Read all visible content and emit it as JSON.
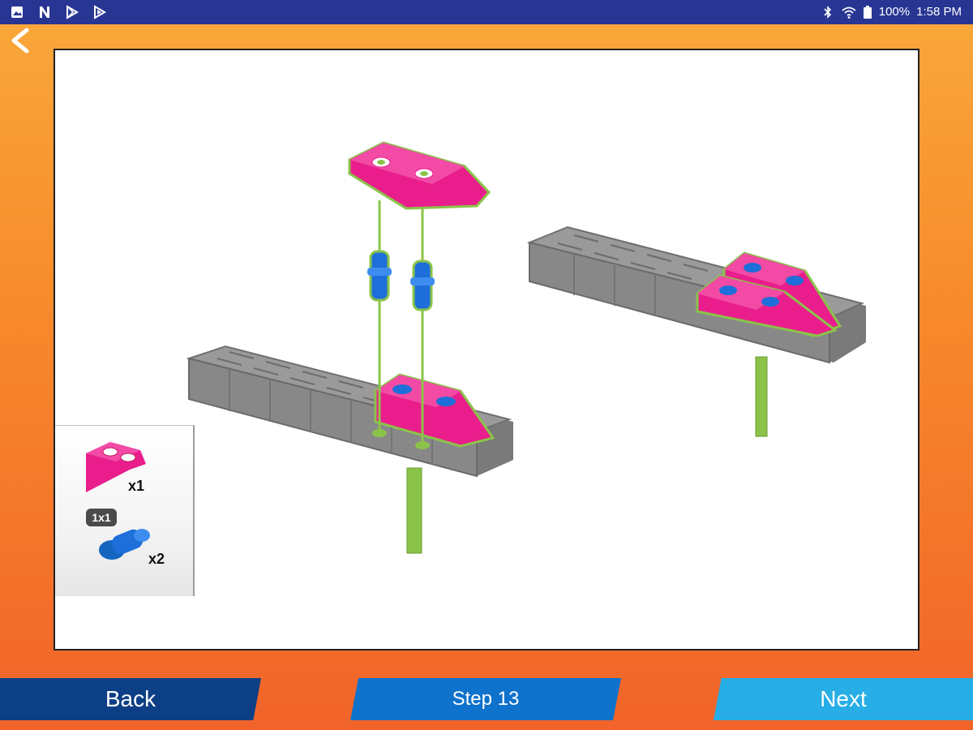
{
  "status_bar": {
    "left_icons": [
      "image-icon",
      "n-app-icon",
      "play-store-icon",
      "play-icon"
    ],
    "right_icons": [
      "bluetooth-icon",
      "wifi-icon",
      "battery-icon"
    ],
    "battery_label": "100%",
    "time": "1:58 PM"
  },
  "parts_list": {
    "items": [
      {
        "icon": "pink-wedge-piece-icon",
        "quantity": "x1"
      },
      {
        "icon": "blue-connector-piece-icon",
        "size_badge": "1x1",
        "quantity": "x2"
      }
    ]
  },
  "nav": {
    "back_label": "Back",
    "step_label": "Step 13",
    "next_label": "Next"
  },
  "colors": {
    "statusbar": "#283593",
    "pink_piece": "#e91e8c",
    "gray_plate": "#8a8a8a",
    "green_axle": "#8bc34a",
    "blue_connector": "#1e6fd9",
    "back_button": "#0d3f86",
    "step_button": "#0f72cc",
    "next_button": "#27aee6"
  }
}
